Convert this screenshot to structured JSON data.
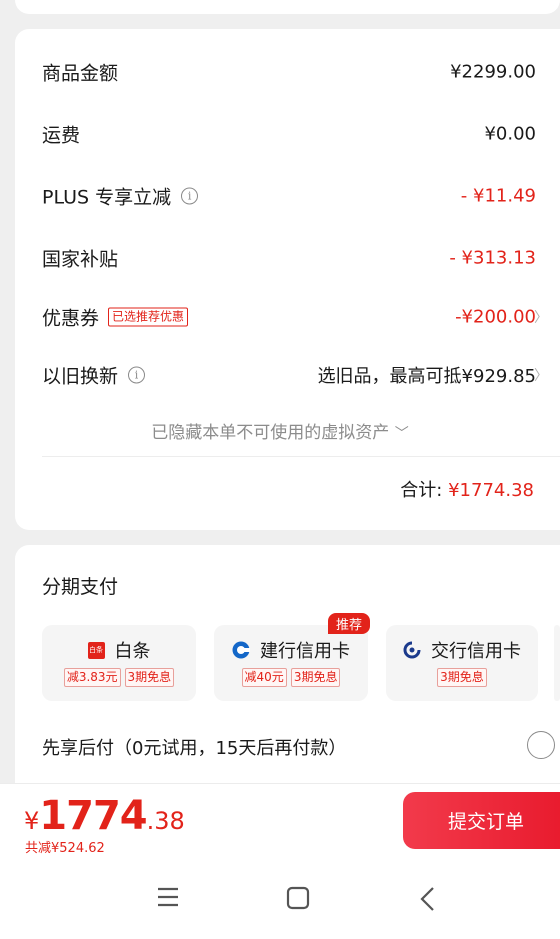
{
  "summary": {
    "rows": [
      {
        "label": "商品金额",
        "value": "¥2299.00"
      },
      {
        "label": "运费",
        "value": "¥0.00"
      },
      {
        "label": "PLUS 专享立减",
        "value": "- ¥11.49"
      },
      {
        "label": "国家补贴",
        "value": "- ¥313.13"
      },
      {
        "label": "优惠券",
        "tag": "已选推荐优惠",
        "value": "-¥200.00"
      },
      {
        "label": "以旧换新",
        "value": "选旧品，最高可抵¥929.85"
      }
    ],
    "virtual_assets": "已隐藏本单不可使用的虚拟资产",
    "total_label": "合计:",
    "total_value": "¥1774.38"
  },
  "installment": {
    "title": "分期支付",
    "options": [
      {
        "name": "白条",
        "icon_text": "白条",
        "tags": [
          "减3.83元",
          "3期免息"
        ]
      },
      {
        "name": "建行信用卡",
        "badge": "推荐",
        "tags": [
          "减40元",
          "3期免息"
        ]
      },
      {
        "name": "交行信用卡",
        "tags": [
          "3期免息"
        ]
      }
    ]
  },
  "bnpl": {
    "label": "先享后付（0元试用，15天后再付款）"
  },
  "footer": {
    "currency": "¥",
    "price_int": "1774",
    "price_dec": ".38",
    "saved": "共减¥524.62",
    "submit": "提交订单"
  },
  "icons": [
    "info-icon",
    "chevron-right-icon",
    "chevron-down-icon",
    "baitiao-icon",
    "ccb-icon",
    "bocom-icon",
    "radio-icon",
    "menu-icon",
    "home-icon",
    "back-icon"
  ],
  "colors": {
    "accent": "#e2231a",
    "background": "#efefef"
  }
}
